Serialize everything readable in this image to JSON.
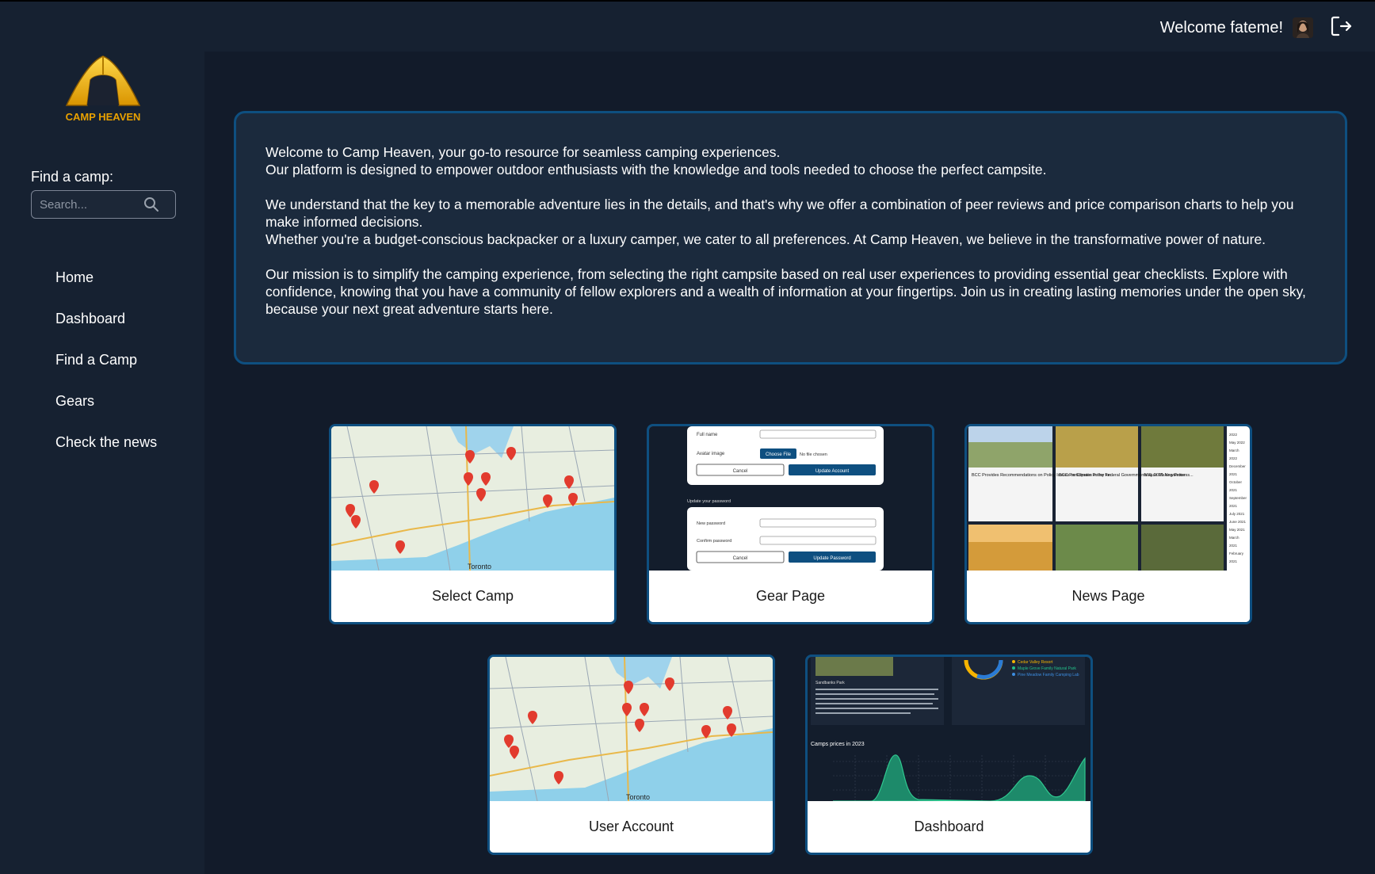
{
  "header": {
    "welcome_text": "Welcome fateme!",
    "avatar_icon": "avatar",
    "logout_icon": "logout-icon"
  },
  "sidebar": {
    "logo_text": "CAMP HEAVEN",
    "find_label": "Find a camp:",
    "search_placeholder": "Search...",
    "nav": [
      {
        "label": "Home"
      },
      {
        "label": "Dashboard"
      },
      {
        "label": "Find a Camp"
      },
      {
        "label": "Gears"
      },
      {
        "label": "Check the news"
      }
    ]
  },
  "intro": {
    "p1_line1": "Welcome to Camp Heaven, your go-to resource for seamless camping experiences.",
    "p1_line2": "Our platform is designed to empower outdoor enthusiasts with the knowledge and tools needed to choose the perfect campsite.",
    "p2_line1": "We understand that the key to a memorable adventure lies in the details, and that's why we offer a combination of peer reviews and price comparison charts to help you make informed decisions.",
    "p2_line2": "Whether you're a budget-conscious backpacker or a luxury camper, we cater to all preferences. At Camp Heaven, we believe in the transformative power of nature.",
    "p3_line1": "Our mission is to simplify the camping experience, from selecting the right campsite based on real user experiences to providing essential gear checklists. Explore with confidence, knowing that you have a community of fellow explorers and a wealth of information at your fingertips. Join us in creating lasting memories under the open sky, because your next great adventure starts here."
  },
  "cards": [
    {
      "label": "Select Camp"
    },
    {
      "label": "Gear Page"
    },
    {
      "label": "News Page"
    },
    {
      "label": "User Account"
    },
    {
      "label": "Dashboard"
    }
  ],
  "thumbs": {
    "map_city": "Toronto",
    "gear": {
      "full_name": "Full name",
      "avatar_image": "Avatar image",
      "choose_file": "Choose File",
      "no_file": "No file chosen",
      "cancel": "Cancel",
      "update_account": "Update Account",
      "update_password_title": "Update your password",
      "new_password": "New password",
      "confirm_password": "Confirm password",
      "update_password": "Update Password"
    },
    "news": {
      "headline1": "BCC Provides Recommendations on Policy Issues on Climate Policy for...",
      "headline2": "BCC Participates in the Federal Governments Rule Making Process...",
      "headline3": "May 2021 Newsletter",
      "months": [
        "2022",
        "May 2022",
        "March",
        "2022",
        "December",
        "2021",
        "October",
        "2021",
        "September",
        "2021",
        "July 2021",
        "June 2021",
        "May 2021",
        "March",
        "2021",
        "February",
        "2021"
      ]
    },
    "dashboard": {
      "park_name": "Sandbanks Park",
      "chart_title": "Camps prices in 2023",
      "legend": [
        "Cedar Valley Resort",
        "Maple Grove Family Natural Park",
        "Pine Meadow Family Camping Lab"
      ]
    }
  },
  "colors": {
    "background": "#121b2a",
    "panel": "#162131",
    "accent_border": "#0e4f80",
    "logo_gold": "#f5b800"
  }
}
